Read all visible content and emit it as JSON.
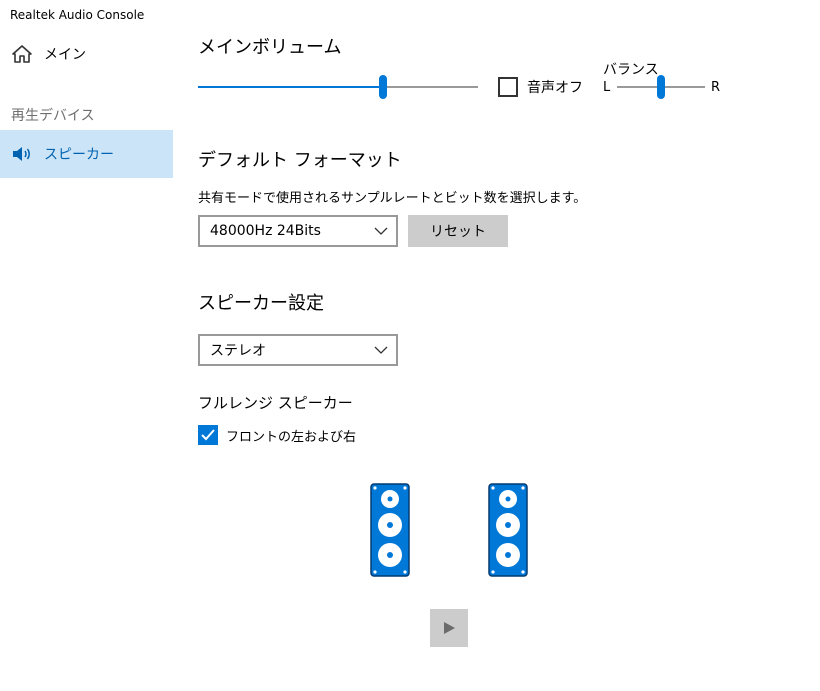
{
  "app": {
    "title": "Realtek Audio Console"
  },
  "sidebar": {
    "main_item": {
      "label": "メイン",
      "icon": "home-icon"
    },
    "section_label": "再生デバイス",
    "devices": [
      {
        "label": "スピーカー",
        "icon": "speaker-icon",
        "selected": true
      }
    ]
  },
  "volume": {
    "heading": "メインボリューム",
    "level": 0.66,
    "mute_label": "音声オフ",
    "muted": false,
    "balance": {
      "title": "バランス",
      "left_label": "L",
      "right_label": "R",
      "value": 0.5
    }
  },
  "format": {
    "heading": "デフォルト フォーマット",
    "description": "共有モードで使用されるサンプルレートとビット数を選択します。",
    "selected": "48000Hz 24Bits",
    "reset_label": "リセット"
  },
  "speaker_config": {
    "heading": "スピーカー設定",
    "selected": "ステレオ",
    "fullrange_title": "フルレンジ スピーカー",
    "front_label": "フロントの左および右",
    "front_checked": true
  },
  "colors": {
    "accent": "#0078d7",
    "selected_bg": "#cce4f7",
    "button_bg": "#cccccc"
  }
}
